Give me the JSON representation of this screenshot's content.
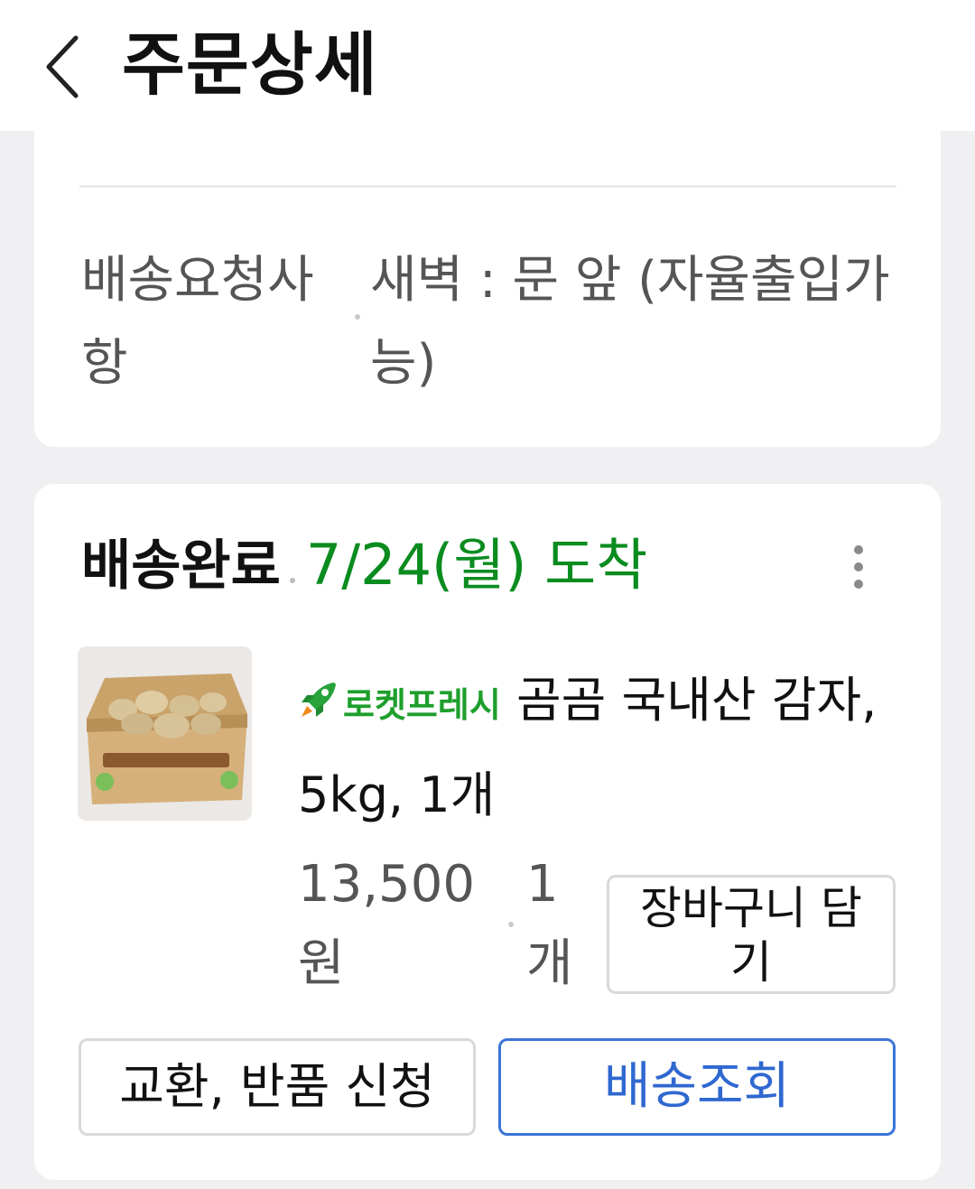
{
  "header": {
    "title": "주문상세",
    "back_icon": "chevron-left-icon"
  },
  "delivery_request": {
    "label": "배송요청사항",
    "value": "새벽 : 문 앞 (자율출입가능)"
  },
  "order": {
    "status": "배송완료",
    "arrival": "7/24(월) 도착",
    "arrival_color": "#0a8c1f",
    "more_icon": "more-vertical-icon",
    "badge": "로켓프레시",
    "badge_icon": "rocket-icon",
    "product_name": "곰곰 국내산 감자, 5kg, 1개",
    "price": "13,500원",
    "quantity": "1개",
    "add_to_cart_label": "장바구니 담기",
    "return_label": "교환, 반품 신청",
    "track_label": "배송조회",
    "track_color": "#2f68d0"
  }
}
